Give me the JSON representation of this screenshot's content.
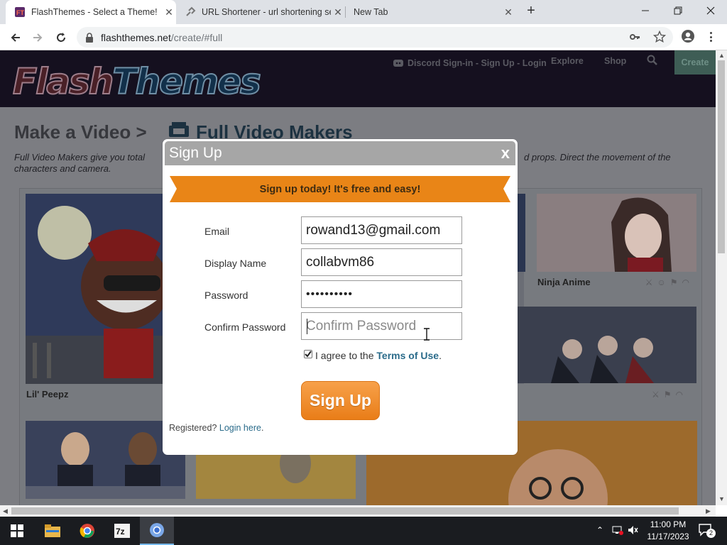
{
  "browser": {
    "tabs": [
      {
        "title": "FlashThemes - Select a Theme!",
        "active": true
      },
      {
        "title": "URL Shortener - url shortening se",
        "active": false
      },
      {
        "title": "New Tab",
        "active": false
      }
    ],
    "url_host": "flashthemes.net",
    "url_path": "/create/#full"
  },
  "site": {
    "logo": {
      "part1": "Flash",
      "part2": "Themes"
    },
    "nav": {
      "signin": "Discord Sign-in - Sign Up - Login",
      "explore": "Explore",
      "shop": "Shop",
      "create": "Create"
    },
    "breadcrumb": {
      "part1": "Make a Video >",
      "part2": "Full Video Makers"
    },
    "description": {
      "line1": "Full Video Makers give you total",
      "line1_end": "d props. Direct the movement of the",
      "line2": "characters and camera."
    },
    "cards": [
      {
        "label": "Lil' Peepz"
      },
      {
        "label": "Ninja Anime"
      }
    ]
  },
  "modal": {
    "title": "Sign Up",
    "close": "x",
    "banner": "Sign up today! It's free and easy!",
    "fields": {
      "email": {
        "label": "Email",
        "value": "rowand13@gmail.com"
      },
      "display_name": {
        "label": "Display Name",
        "value": "collabvm86"
      },
      "password": {
        "label": "Password",
        "value": "••••••••••"
      },
      "confirm_password": {
        "label": "Confirm Password",
        "value": "",
        "placeholder": "Confirm Password"
      }
    },
    "terms": {
      "prefix": "I agree to the ",
      "link": "Terms of Use",
      "suffix": ".",
      "checked": true
    },
    "submit": "Sign Up",
    "registered": {
      "prefix": "Registered? ",
      "link": "Login here",
      "suffix": "."
    }
  },
  "taskbar": {
    "time": "11:00 PM",
    "date": "11/17/2023",
    "notifications": "2"
  },
  "colors": {
    "accent_orange": "#e98517",
    "link_blue": "#2a6b8a",
    "modal_header": "#a6a6a6"
  }
}
